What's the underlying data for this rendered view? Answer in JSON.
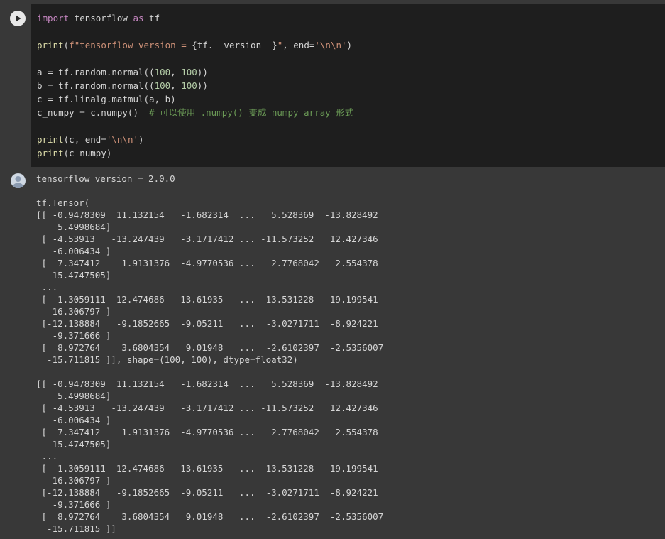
{
  "code_cell": {
    "run_icon": "play-icon",
    "lines": [
      [
        {
          "c": "kw",
          "t": "import"
        },
        {
          "c": "pl",
          "t": " tensorflow "
        },
        {
          "c": "kw",
          "t": "as"
        },
        {
          "c": "pl",
          "t": " tf"
        }
      ],
      [],
      [
        {
          "c": "fn",
          "t": "print"
        },
        {
          "c": "pl",
          "t": "("
        },
        {
          "c": "str",
          "t": "f\"tensorflow version = "
        },
        {
          "c": "pl",
          "t": "{tf.__version__}"
        },
        {
          "c": "str",
          "t": "\""
        },
        {
          "c": "pl",
          "t": ", end="
        },
        {
          "c": "str",
          "t": "'\\n\\n'"
        },
        {
          "c": "pl",
          "t": ")"
        }
      ],
      [],
      [
        {
          "c": "pl",
          "t": "a = tf.random.normal(("
        },
        {
          "c": "num",
          "t": "100"
        },
        {
          "c": "pl",
          "t": ", "
        },
        {
          "c": "num",
          "t": "100"
        },
        {
          "c": "pl",
          "t": "))"
        }
      ],
      [
        {
          "c": "pl",
          "t": "b = tf.random.normal(("
        },
        {
          "c": "num",
          "t": "100"
        },
        {
          "c": "pl",
          "t": ", "
        },
        {
          "c": "num",
          "t": "100"
        },
        {
          "c": "pl",
          "t": "))"
        }
      ],
      [
        {
          "c": "pl",
          "t": "c = tf.linalg.matmul(a, b)"
        }
      ],
      [
        {
          "c": "pl",
          "t": "c_numpy = c.numpy()  "
        },
        {
          "c": "cm",
          "t": "# 可以使用 .numpy() 变成 numpy array 形式"
        }
      ],
      [],
      [
        {
          "c": "fn",
          "t": "print"
        },
        {
          "c": "pl",
          "t": "(c, end="
        },
        {
          "c": "str",
          "t": "'\\n\\n'"
        },
        {
          "c": "pl",
          "t": ")"
        }
      ],
      [
        {
          "c": "fn",
          "t": "print"
        },
        {
          "c": "pl",
          "t": "(c_numpy)"
        }
      ]
    ]
  },
  "output_cell": {
    "icon": "output-avatar-icon",
    "text": "tensorflow version = 2.0.0\n\ntf.Tensor(\n[[ -0.9478309  11.132154   -1.682314  ...   5.528369  -13.828492\n    5.4998684]\n [ -4.53913   -13.247439   -3.1717412 ... -11.573252   12.427346\n   -6.006434 ]\n [  7.347412    1.9131376  -4.9770536 ...   2.7768042   2.554378\n   15.4747505]\n ...\n [  1.3059111 -12.474686  -13.61935   ...  13.531228  -19.199541\n   16.306797 ]\n [-12.138884   -9.1852665  -9.05211   ...  -3.0271711  -8.924221\n   -9.371666 ]\n [  8.972764    3.6804354   9.01948   ...  -2.6102397  -2.5356007\n  -15.711815 ]], shape=(100, 100), dtype=float32)\n\n[[ -0.9478309  11.132154   -1.682314  ...   5.528369  -13.828492\n    5.4998684]\n [ -4.53913   -13.247439   -3.1717412 ... -11.573252   12.427346\n   -6.006434 ]\n [  7.347412    1.9131376  -4.9770536 ...   2.7768042   2.554378\n   15.4747505]\n ...\n [  1.3059111 -12.474686  -13.61935   ...  13.531228  -19.199541\n   16.306797 ]\n [-12.138884   -9.1852665  -9.05211   ...  -3.0271711  -8.924221\n   -9.371666 ]\n [  8.972764    3.6804354   9.01948   ...  -2.6102397  -2.5356007\n  -15.711815 ]]"
  },
  "colors": {
    "code_background": "#1e1e1e",
    "output_background": "#383838",
    "keyword": "#c586c0",
    "function": "#dcdcaa",
    "string": "#ce9178",
    "number": "#b5cea8",
    "comment": "#6a9955"
  }
}
